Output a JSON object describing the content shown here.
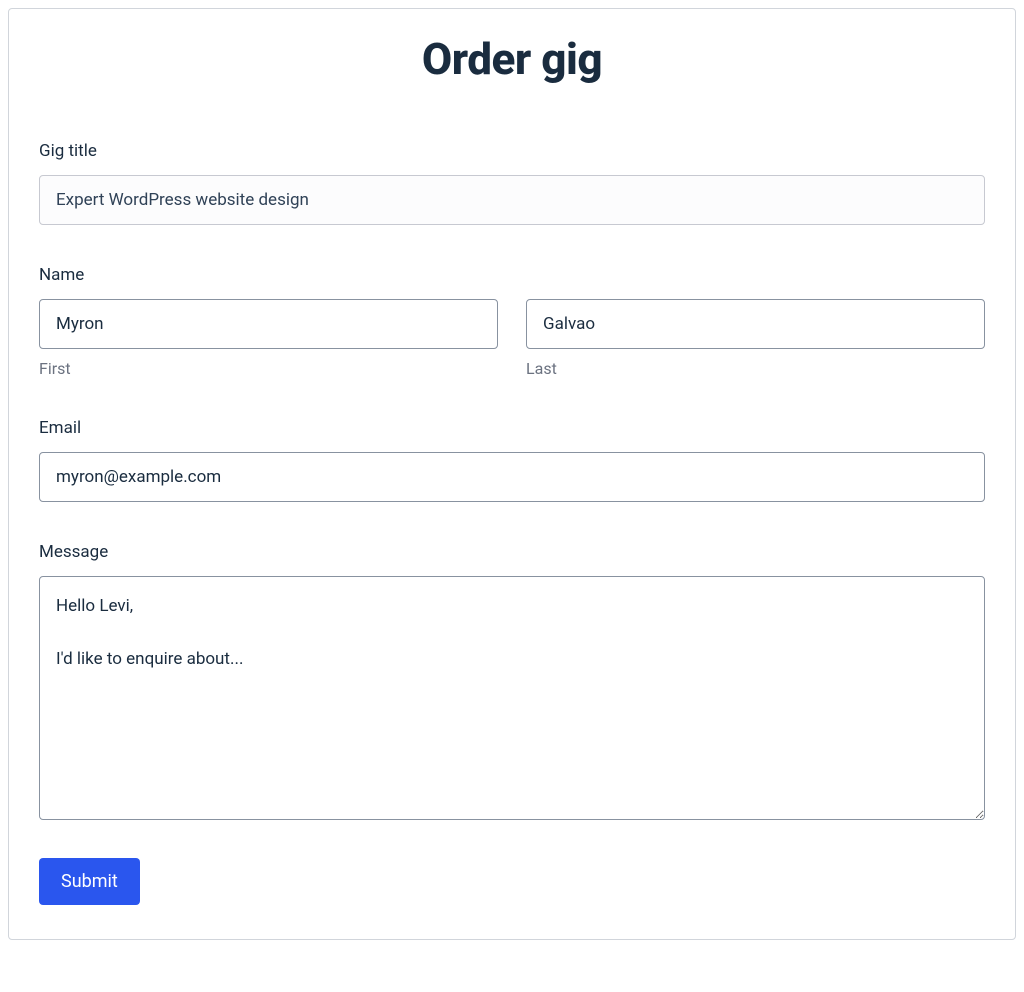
{
  "title": "Order gig",
  "fields": {
    "gig_title": {
      "label": "Gig title",
      "value": "Expert WordPress website design"
    },
    "name": {
      "label": "Name",
      "first": {
        "value": "Myron",
        "sublabel": "First"
      },
      "last": {
        "value": "Galvao",
        "sublabel": "Last"
      }
    },
    "email": {
      "label": "Email",
      "value": "myron@example.com"
    },
    "message": {
      "label": "Message",
      "value": "Hello Levi,\n\nI'd like to enquire about..."
    }
  },
  "submit_label": "Submit"
}
